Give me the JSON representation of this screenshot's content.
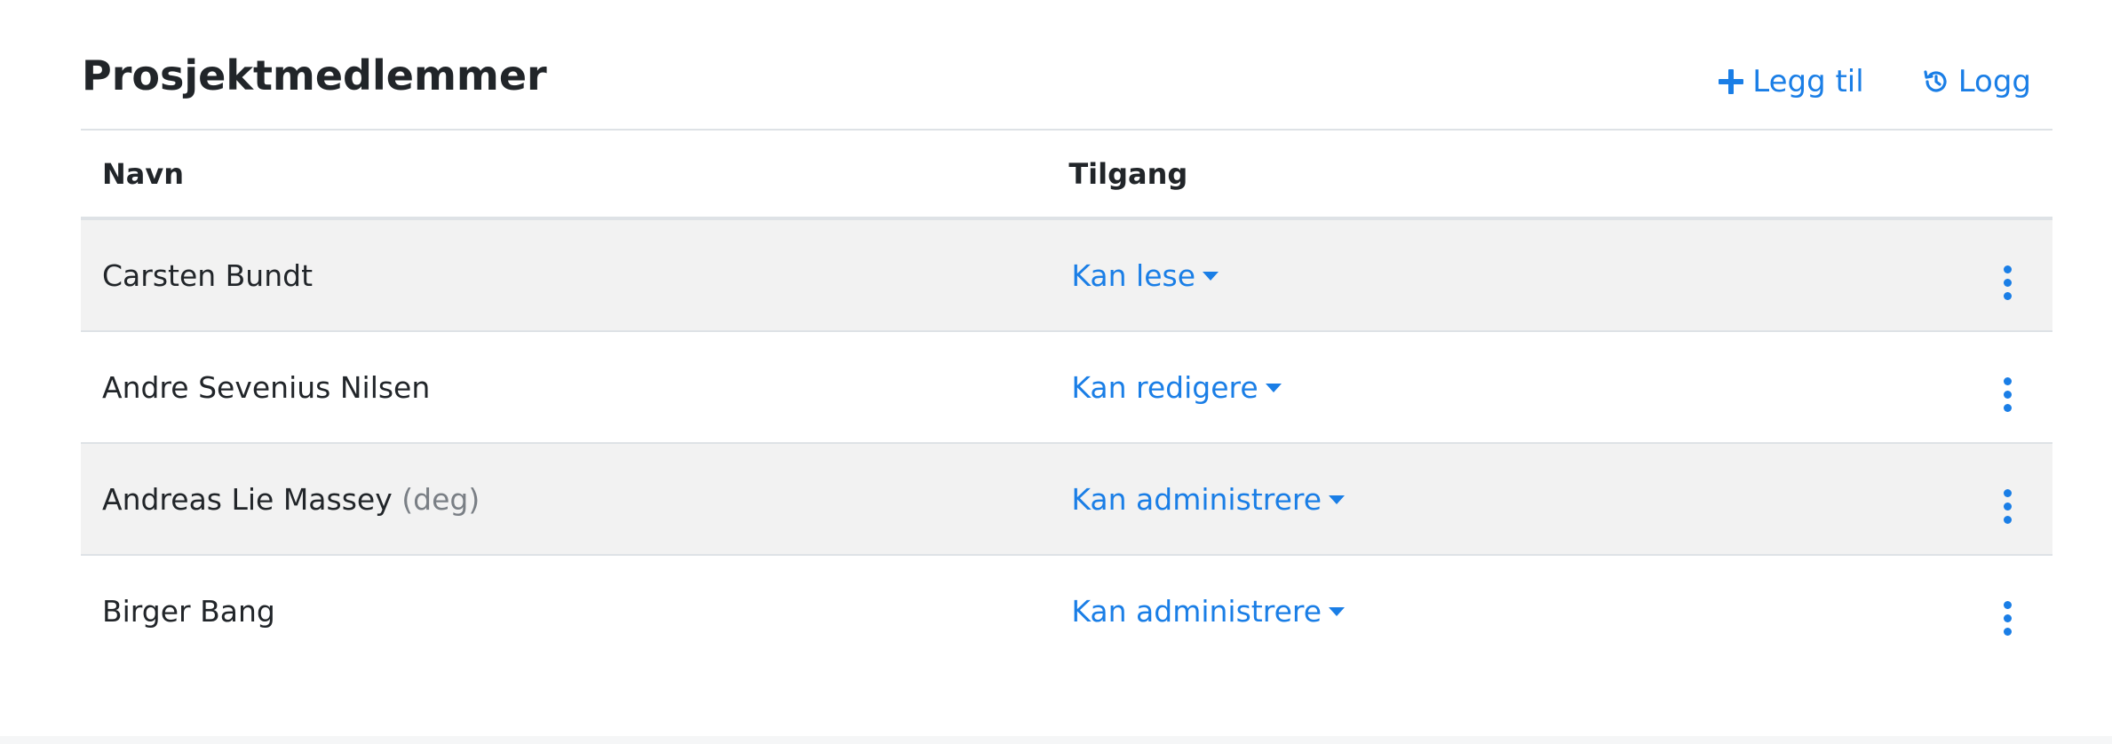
{
  "header": {
    "title": "Prosjektmedlemmer",
    "add_label": "Legg til",
    "log_label": "Logg"
  },
  "table": {
    "columns": [
      "Navn",
      "Tilgang"
    ],
    "rows": [
      {
        "name": "Carsten Bundt",
        "suffix": "",
        "access": "Kan lese"
      },
      {
        "name": "Andre Sevenius Nilsen",
        "suffix": "",
        "access": "Kan redigere"
      },
      {
        "name": "Andreas Lie Massey",
        "suffix": "(deg)",
        "access": "Kan administrere"
      },
      {
        "name": "Birger Bang",
        "suffix": "",
        "access": "Kan administrere"
      }
    ]
  },
  "icons": {
    "add": "plus-icon",
    "log": "history-icon",
    "caret": "caret-down-icon",
    "row_menu": "more-vertical-icon"
  },
  "colors": {
    "accent": "#1a7ee6",
    "striped_row": "#f2f2f2",
    "muted": "#7a7f85"
  }
}
